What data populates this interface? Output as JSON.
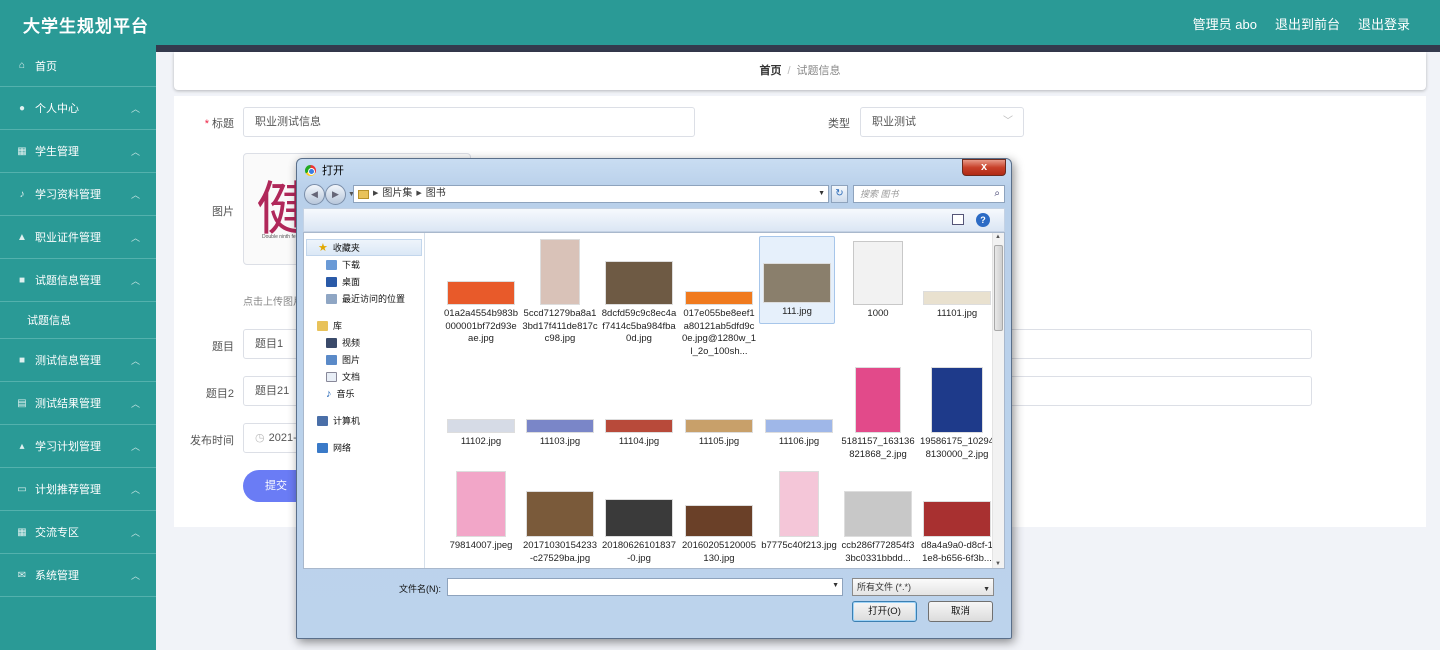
{
  "topbar": {
    "brand": "大学生规划平台",
    "admin": "管理员 abo",
    "to_front": "退出到前台",
    "logout": "退出登录"
  },
  "sidebar": {
    "items": [
      {
        "label": "首页",
        "icon": "home-icon"
      },
      {
        "label": "个人中心",
        "icon": "user-icon"
      },
      {
        "label": "学生管理",
        "icon": "grid-icon"
      },
      {
        "label": "学习资料管理",
        "icon": "mic-icon"
      },
      {
        "label": "职业证件管理",
        "icon": "person-icon"
      },
      {
        "label": "试题信息管理",
        "icon": "chat-icon",
        "sub": "试题信息"
      },
      {
        "label": "测试信息管理",
        "icon": "chat-icon"
      },
      {
        "label": "测试结果管理",
        "icon": "clipboard-icon"
      },
      {
        "label": "学习计划管理",
        "icon": "thumb-icon"
      },
      {
        "label": "计划推荐管理",
        "icon": "inbox-icon"
      },
      {
        "label": "交流专区",
        "icon": "grid-icon"
      },
      {
        "label": "系统管理",
        "icon": "mail-icon"
      }
    ]
  },
  "breadcrumb": {
    "home": "首页",
    "sep": "/",
    "current": "试题信息"
  },
  "form": {
    "title_label": "标题",
    "title_value": "职业测试信息",
    "type_label": "类型",
    "type_value": "职业测试",
    "image_label": "图片",
    "image_big_char": "健",
    "image_small_text": "Double ninth fe",
    "upload_hint": "点击上传图片",
    "q1_label": "题目",
    "q1_value": "题目1",
    "q2_label": "题目2",
    "q2_value": "题目21",
    "date_label": "发布时间",
    "date_value": "2021-0",
    "submit": "提交"
  },
  "dialog": {
    "title": "打开",
    "close": "x",
    "path": [
      "图片集",
      "图书"
    ],
    "search_placeholder": "搜索 图书",
    "nav": {
      "favorites": "收藏夹",
      "downloads": "下载",
      "desktop": "桌面",
      "recent": "最近访问的位置",
      "library": "库",
      "video": "视频",
      "pictures": "图片",
      "documents": "文档",
      "music": "音乐",
      "computer": "计算机",
      "network": "网络"
    },
    "files": [
      {
        "name": "01a2a4554b983b000001bf72d93eae.jpg",
        "color": "#e85a2a"
      },
      {
        "name": "5ccd71279ba8a13bd17f411de817cc98.jpg",
        "color": "#d9c2b8"
      },
      {
        "name": "8dcfd59c9c8ec4af7414c5ba984fba0d.jpg",
        "color": "#6e5a44"
      },
      {
        "name": "017e055be8eef1a80121ab5dfd9c0e.jpg@1280w_1l_2o_100sh...",
        "color": "#f07a1e"
      },
      {
        "name": "111.jpg",
        "color": "#8a7f6c"
      },
      {
        "name": "1000",
        "color": "#f2f2f2"
      },
      {
        "name": "11101.jpg",
        "color": "#e9e1cf"
      },
      {
        "name": "11102.jpg",
        "color": "#d6dbe6"
      },
      {
        "name": "11103.jpg",
        "color": "#7a86c8"
      },
      {
        "name": "11104.jpg",
        "color": "#b84a3a"
      },
      {
        "name": "11105.jpg",
        "color": "#c8a06a"
      },
      {
        "name": "11106.jpg",
        "color": "#9fb7e8"
      },
      {
        "name": "5181157_163136821868_2.jpg",
        "color": "#e24a8a"
      },
      {
        "name": "19586175_102948130000_2.jpg",
        "color": "#1e3a8a"
      },
      {
        "name": "79814007.jpeg",
        "color": "#f2a6c8"
      },
      {
        "name": "20171030154233-c27529ba.jpg",
        "color": "#7a5a3a"
      },
      {
        "name": "20180626101837-0.jpg",
        "color": "#3a3a3a"
      },
      {
        "name": "20160205120005130.jpg",
        "color": "#6a4028"
      },
      {
        "name": "b7775c40f213.jpg",
        "color": "#f4c6d8"
      },
      {
        "name": "ccb286f772854f33bc0331bbdd...",
        "color": "#c8c8c8"
      },
      {
        "name": "d8a4a9a0-d8cf-11e8-b656-6f3b...",
        "color": "#a83030"
      }
    ],
    "filename_label": "文件名(N):",
    "filetype_value": "所有文件 (*.*)",
    "open_button": "打开(O)",
    "cancel_button": "取消"
  }
}
